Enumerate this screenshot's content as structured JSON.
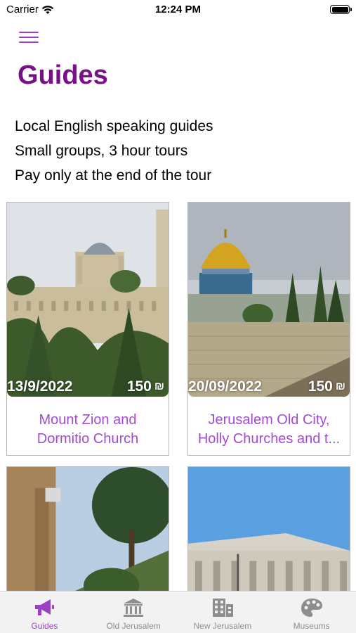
{
  "status_bar": {
    "carrier": "Carrier",
    "time": "12:24 PM"
  },
  "page": {
    "title": "Guides",
    "intro_lines": [
      "Local English speaking guides",
      "Small groups, 3 hour tours",
      "Pay only at the end of the tour"
    ]
  },
  "tours": [
    {
      "date": "13/9/2022",
      "price": "150",
      "currency": "₪",
      "title_line1": "Mount Zion and",
      "title_line2": "Dormitio Church"
    },
    {
      "date": "20/09/2022",
      "price": "150",
      "currency": "₪",
      "title_line1": "Jerusalem Old City,",
      "title_line2": "Holly Churches and t..."
    }
  ],
  "tab_bar": {
    "tabs": [
      {
        "label": "Guides",
        "icon": "megaphone-icon",
        "active": true
      },
      {
        "label": "Old Jerusalem",
        "icon": "building-columns-icon",
        "active": false
      },
      {
        "label": "New Jerusalem",
        "icon": "city-building-icon",
        "active": false
      },
      {
        "label": "Museums",
        "icon": "palette-icon",
        "active": false
      }
    ]
  },
  "colors": {
    "accent": "#9b3fc6",
    "title": "#7a0f8a",
    "card_title": "#a34ad6"
  }
}
